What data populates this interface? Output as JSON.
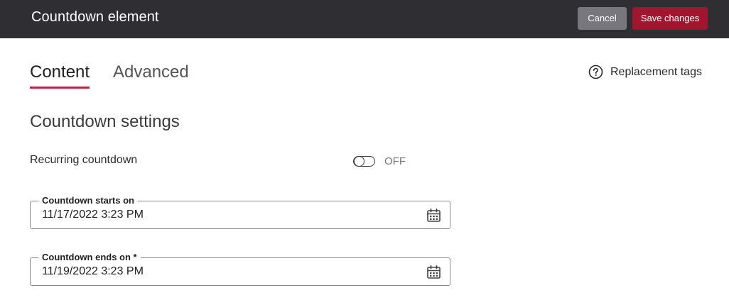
{
  "header": {
    "title": "Countdown element",
    "cancel_label": "Cancel",
    "save_label": "Save changes"
  },
  "tabs": [
    {
      "label": "Content",
      "active": true
    },
    {
      "label": "Advanced",
      "active": false
    }
  ],
  "help": {
    "label": "Replacement tags",
    "icon": "help-circle-icon"
  },
  "section": {
    "title": "Countdown settings"
  },
  "recurring": {
    "label": "Recurring countdown",
    "state": "OFF"
  },
  "fields": [
    {
      "label": "Countdown starts on",
      "value": "11/17/2022 3:23 PM",
      "icon": "calendar-icon"
    },
    {
      "label": "Countdown ends on *",
      "value": "11/19/2022 3:23 PM",
      "icon": "calendar-icon"
    }
  ],
  "colors": {
    "header_bg": "#2f2e33",
    "accent": "#c81e45",
    "save_button": "#a3142f",
    "cancel_button": "#78777d"
  }
}
